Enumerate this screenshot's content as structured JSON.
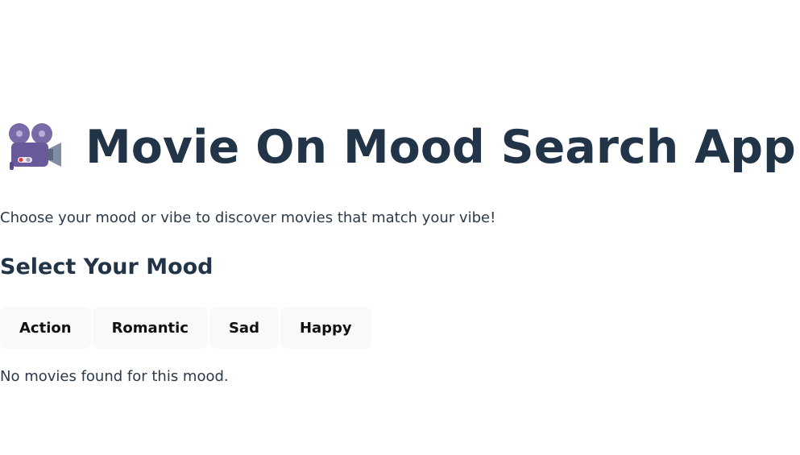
{
  "header": {
    "icon": "movie-camera-icon",
    "title": "Movie On Mood Search App"
  },
  "intro": {
    "subtitle": "Choose your mood or vibe to discover movies that match your vibe!"
  },
  "mood_section": {
    "title": "Select Your Mood",
    "moods": [
      "Action",
      "Romantic",
      "Sad",
      "Happy"
    ]
  },
  "results": {
    "empty_message": "No movies found for this mood."
  },
  "colors": {
    "heading": "#223548",
    "text": "#2b3a4a",
    "button_bg": "#f9f9f9",
    "camera_body": "#6a5a9c"
  }
}
